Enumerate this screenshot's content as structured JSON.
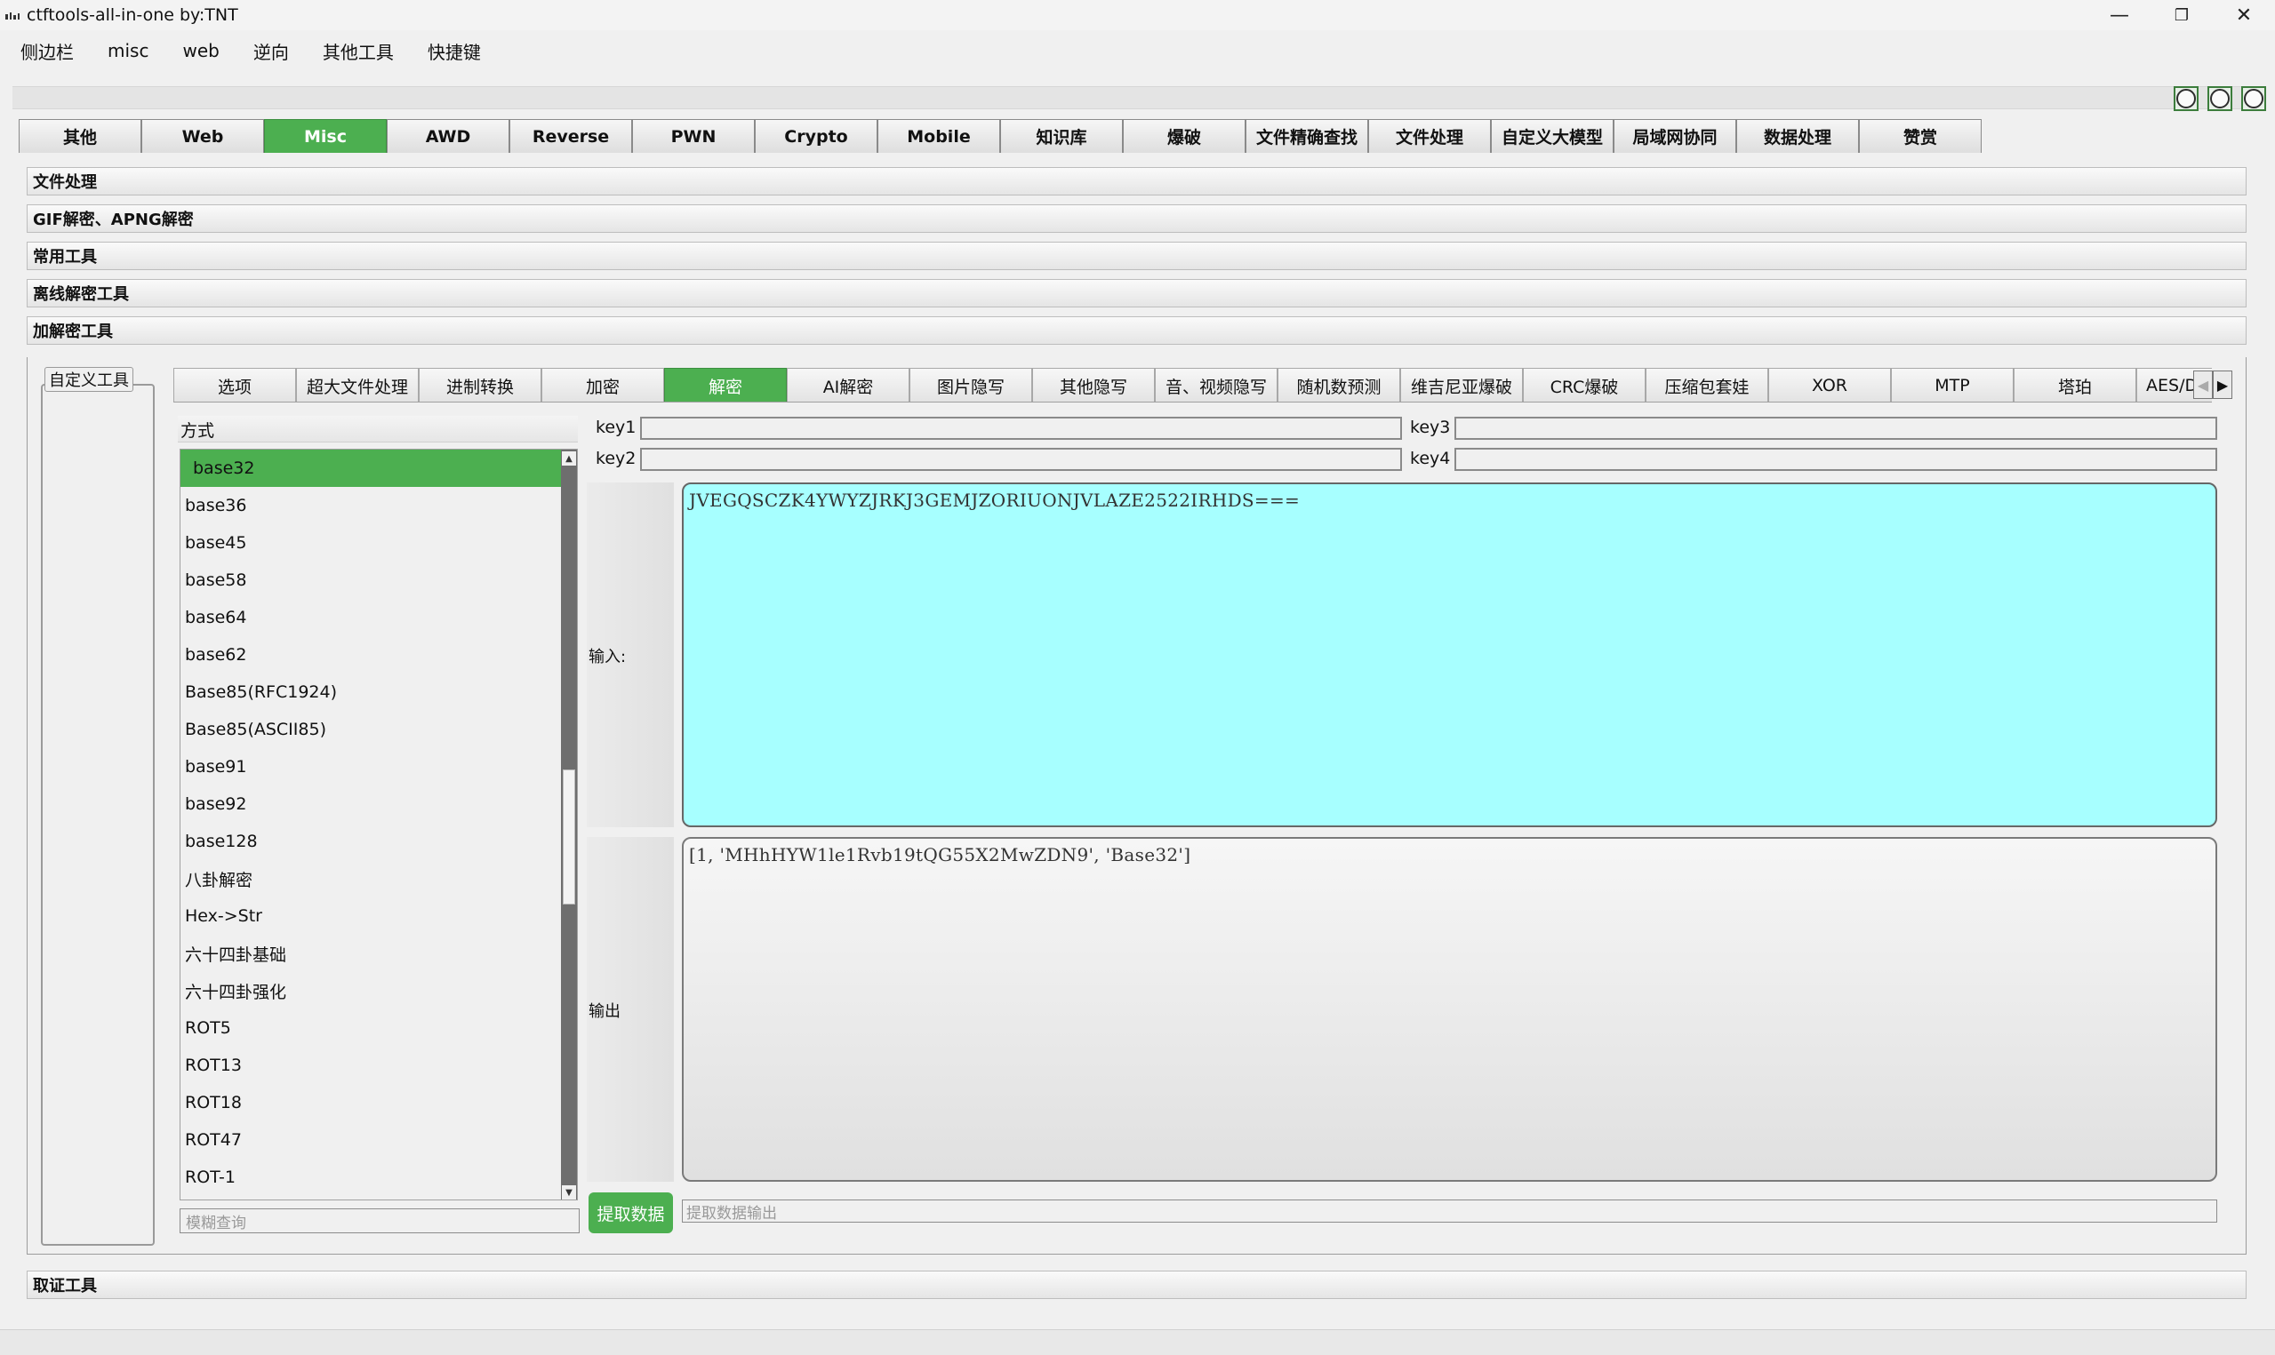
{
  "window": {
    "title": "ctftools-all-in-one   by:TNT",
    "controls": [
      "—",
      "❐",
      "✕"
    ]
  },
  "menubar": [
    "侧边栏",
    "misc",
    "web",
    "逆向",
    "其他工具",
    "快捷键"
  ],
  "top_tabs": {
    "items": [
      "其他",
      "Web",
      "Misc",
      "AWD",
      "Reverse",
      "PWN",
      "Crypto",
      "Mobile",
      "知识库",
      "爆破",
      "文件精确查找",
      "文件处理",
      "自定义大模型",
      "局域网协同",
      "数据处理",
      "赞赏"
    ],
    "active": "Misc"
  },
  "accordion": {
    "file_processing": "文件处理",
    "gif_apng": "GIF解密、APNG解密",
    "common_tools": "常用工具",
    "offline_decrypt": "离线解密工具",
    "encrypt_decrypt": "加解密工具",
    "forensics": "取证工具"
  },
  "custom_tools": "自定义工具",
  "sub_tabs": {
    "items": [
      "选项",
      "超大文件处理",
      "进制转换",
      "加密",
      "解密",
      "AI解密",
      "图片隐写",
      "其他隐写",
      "音、视频隐写",
      "随机数预测",
      "维吉尼亚爆破",
      "CRC爆破",
      "压缩包套娃",
      "XOR",
      "MTP",
      "塔珀",
      "AES/D"
    ],
    "active": "解密"
  },
  "method": {
    "label": "方式",
    "selected": "base32",
    "items": [
      "base32",
      "base36",
      "base45",
      "base58",
      "base64",
      "base62",
      "Base85(RFC1924)",
      "Base85(ASCII85)",
      "base91",
      "base92",
      "base128",
      "八卦解密",
      "Hex->Str",
      "六十四卦基础",
      "六十四卦强化",
      "ROT5",
      "ROT13",
      "ROT18",
      "ROT47",
      "ROT-1"
    ],
    "search_placeholder": "模糊查询"
  },
  "keys": {
    "key1": "key1",
    "key2": "key2",
    "key3": "key3",
    "key4": "key4"
  },
  "io": {
    "input_label": "输入:",
    "input_value": "JVEGQSCZK4YWYZJRKJ3GEMJZORIUONJVLAZE2522IRHDS===",
    "output_label": "输出",
    "output_value": "[1, 'MHhHYW1le1Rvb19tQG55X2MwZDN9', 'Base32']",
    "extract_button": "提取数据",
    "extract_placeholder": "提取数据输出"
  },
  "colors": {
    "accent": "#4caf50",
    "input_bg": "#a7ffff"
  }
}
